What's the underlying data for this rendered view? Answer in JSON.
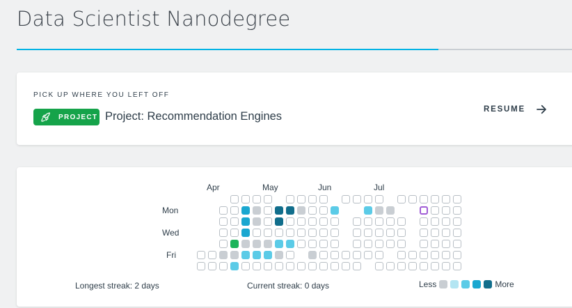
{
  "page": {
    "title": "Data Scientist Nanodegree",
    "progress_percent": 76
  },
  "resume_card": {
    "kicker": "PICK UP WHERE YOU LEFT OFF",
    "badge_label": "PROJECT",
    "badge_icon": "rocket-icon",
    "project_title": "Project: Recommendation Engines",
    "resume_label": "RESUME",
    "resume_icon": "arrow-right-icon",
    "badge_color": "#15a34a"
  },
  "activity": {
    "months": [
      "Apr",
      "May",
      "Jun",
      "Jul"
    ],
    "day_labels": [
      "Mon",
      "Wed",
      "Fri"
    ],
    "grid_rows": [
      "....0000.0000.0000.000000",
      "...00310441002..211..P000",
      "...00310400000.00000.0000",
      "...00300000000.00000.0000",
      "...0G111220000.00000.0000",
      ".001122210.1000000.000000",
      ".000200000000000.00000000"
    ],
    "legend_colors": [
      "#c9ced3",
      "#b3e5f2",
      "#5bcbe7",
      "#1aa7d0",
      "#116e8c"
    ],
    "longest_streak": "Longest streak: 2 days",
    "current_streak": "Current streak: 0 days",
    "legend_less": "Less",
    "legend_more": "More"
  }
}
